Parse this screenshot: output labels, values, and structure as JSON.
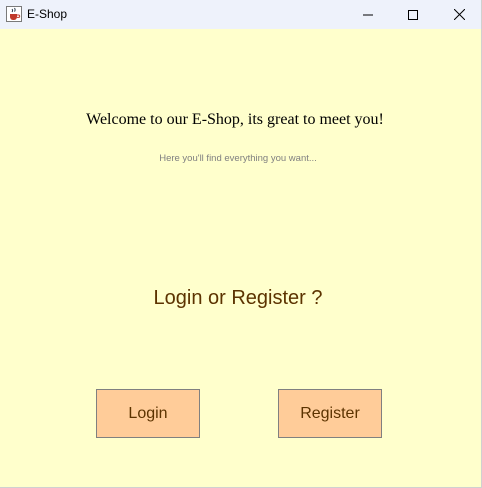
{
  "window": {
    "title": "E-Shop",
    "app_icon": "java-cup-icon",
    "controls": {
      "minimize": "minimize-icon",
      "maximize": "maximize-icon",
      "close": "close-icon"
    }
  },
  "main": {
    "welcome_text": "Welcome to our E-Shop, its great to meet you!",
    "subtitle_text": "Here you'll find everything you want...",
    "prompt_text": "Login or Register ?",
    "login_label": "Login",
    "register_label": "Register"
  },
  "colors": {
    "background": "#ffffcc",
    "button_fill": "#ffcc99",
    "accent_text": "#5c3300",
    "subtitle_text": "#808080",
    "titlebar": "#eef2fb"
  }
}
